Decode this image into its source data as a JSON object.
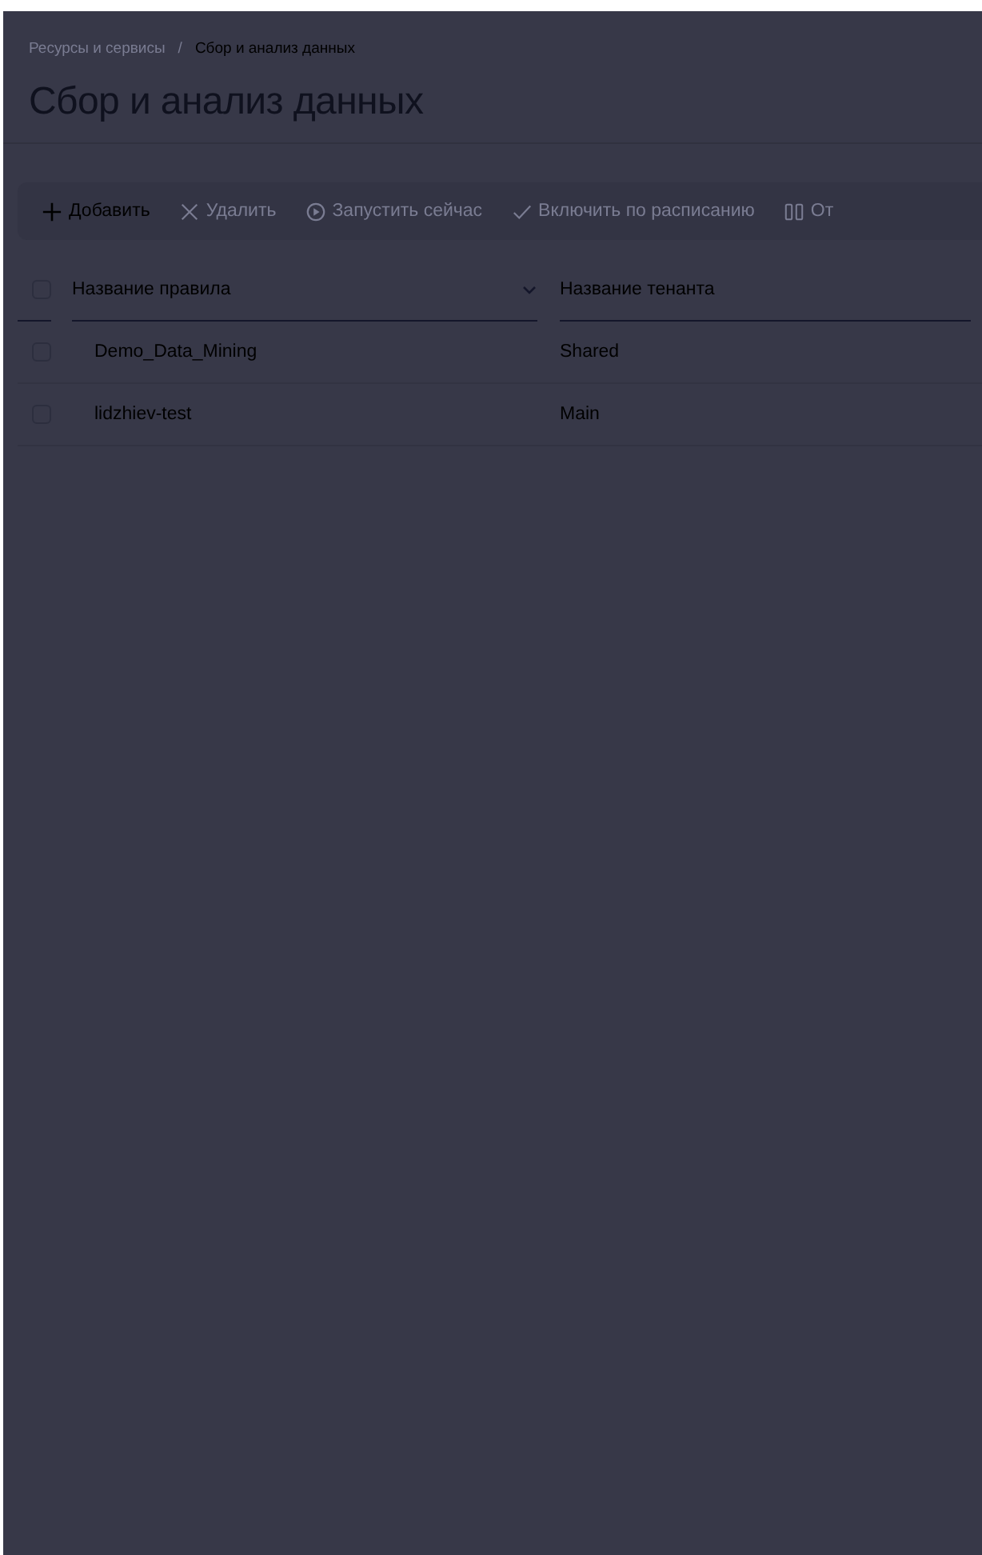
{
  "breadcrumbs": [
    "Ресурсы и сервисы",
    "Сбор и анализ данных"
  ],
  "breadcrumb_separator": "/",
  "title": "Сбор и анализ данных",
  "toolbar": [
    {
      "kind": "plus",
      "label": "Добавить",
      "disabled": false
    },
    {
      "kind": "cross",
      "label": "Удалить",
      "disabled": true
    },
    {
      "kind": "play",
      "label": "Запустить сейчас",
      "disabled": true
    },
    {
      "kind": "check",
      "label": "Включить по расписанию",
      "disabled": true
    },
    {
      "kind": "columns",
      "label": "От",
      "disabled": true
    }
  ],
  "table": {
    "select_all": {
      "checked": false
    },
    "columns": [
      {
        "label": "Название правила",
        "sortable": true
      },
      {
        "label": "Название тенанта",
        "sortable": false
      }
    ],
    "rows": [
      {
        "checked": false,
        "cells": [
          "Demo_Data_Mining",
          "Shared"
        ]
      },
      {
        "checked": false,
        "cells": [
          "lidzhiev-test",
          "Main"
        ]
      }
    ]
  }
}
